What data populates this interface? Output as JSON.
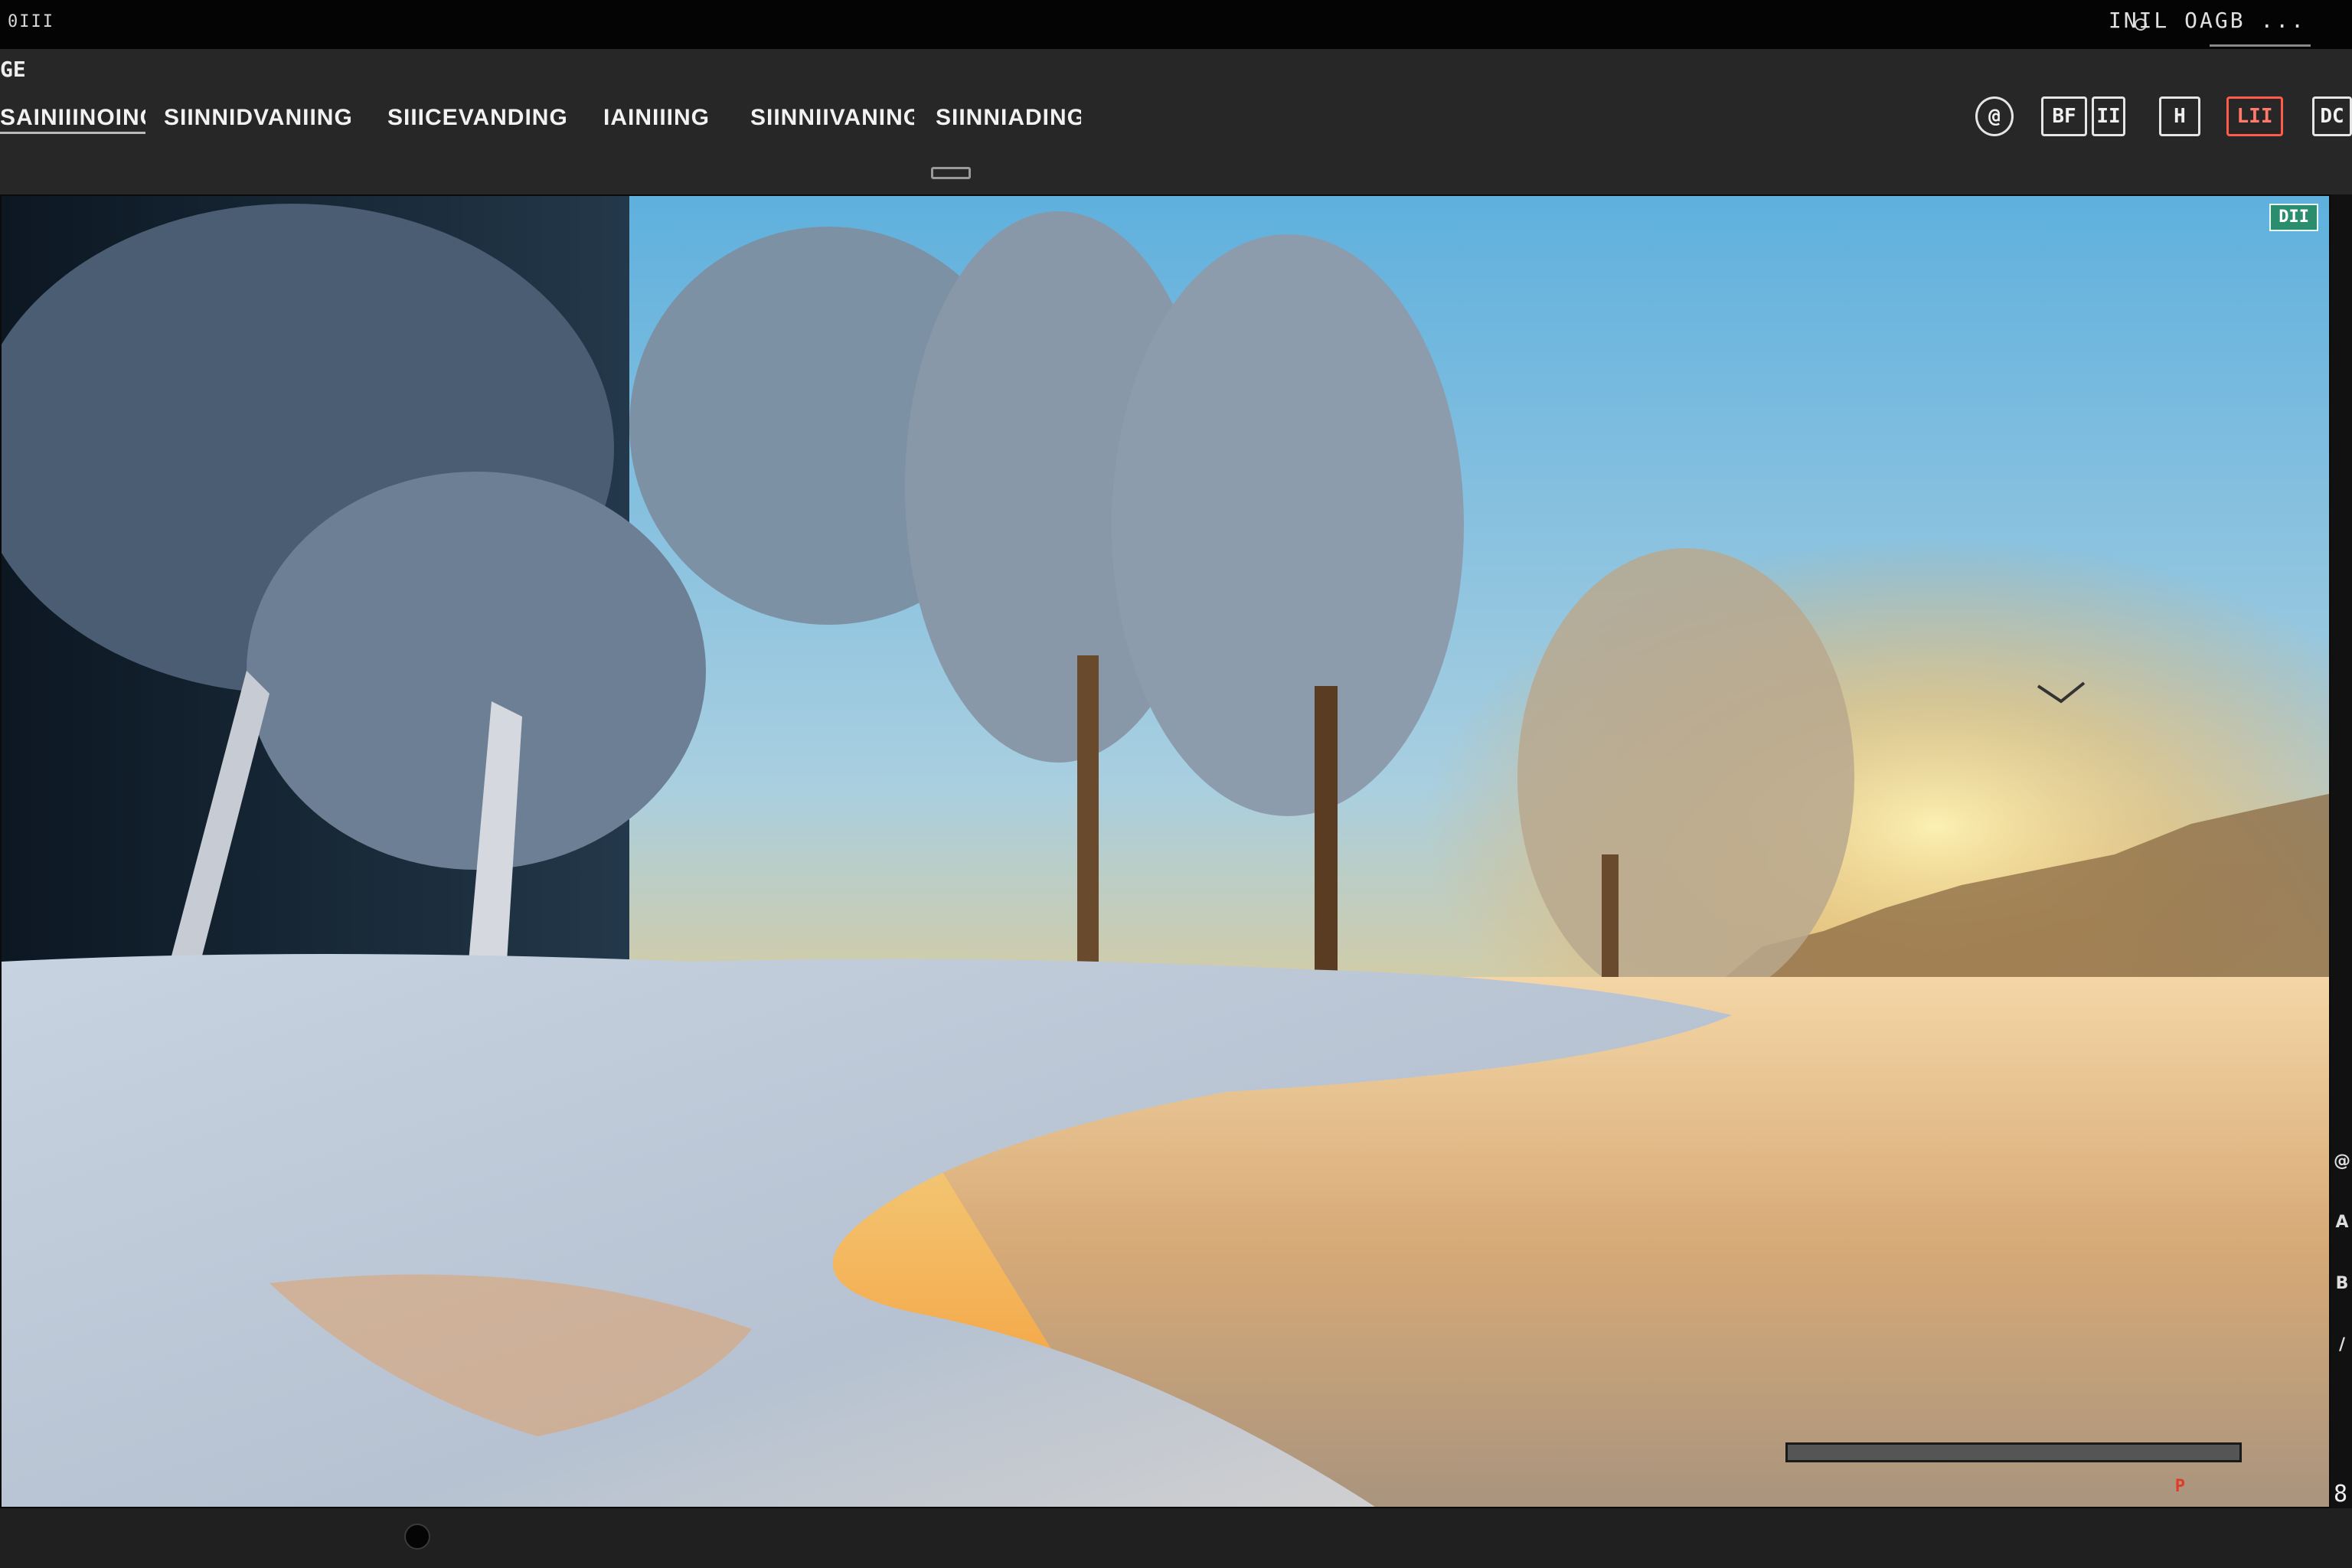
{
  "window": {
    "title_left": "0III",
    "title_right": "INIL OAGB ..."
  },
  "app": {
    "label": "GE"
  },
  "tabs": [
    {
      "label": "SAINIIINOING",
      "active": true
    },
    {
      "label": "SIINNIDVANIING",
      "active": false
    },
    {
      "label": "SIIICEVANDING",
      "active": false
    },
    {
      "label": "IAINIIING",
      "active": false
    },
    {
      "label": "SIINNIIVANING",
      "active": false
    },
    {
      "label": "SIINNIADING",
      "active": false
    }
  ],
  "toolbar": {
    "tools": [
      {
        "label": "@",
        "icon": "target-icon",
        "variant": "round"
      },
      {
        "label": "BF",
        "icon": "brush-icon",
        "variant": ""
      },
      {
        "label": "II",
        "icon": "pause-icon",
        "variant": ""
      },
      {
        "label": "H",
        "icon": "grid-icon",
        "variant": ""
      },
      {
        "label": "LII",
        "icon": "record-icon",
        "variant": "red"
      },
      {
        "label": "DC",
        "icon": "camera-icon",
        "variant": ""
      }
    ]
  },
  "viewport": {
    "badge": "DII",
    "status_mark": "P",
    "page_number": "8"
  },
  "side_tools": [
    "@",
    "A",
    "B",
    "/"
  ]
}
